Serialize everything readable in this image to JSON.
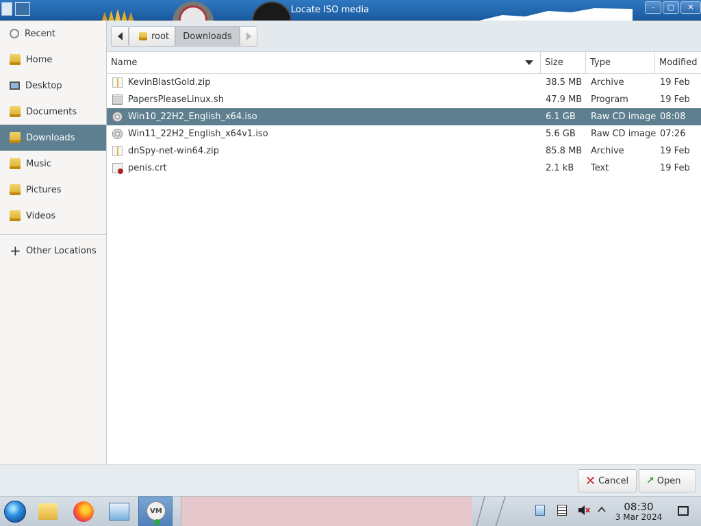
{
  "window": {
    "title": "Locate ISO media"
  },
  "sidebar": {
    "items": [
      {
        "label": "Recent"
      },
      {
        "label": "Home"
      },
      {
        "label": "Desktop"
      },
      {
        "label": "Documents"
      },
      {
        "label": "Downloads"
      },
      {
        "label": "Music"
      },
      {
        "label": "Pictures"
      },
      {
        "label": "Videos"
      }
    ],
    "other_locations": "Other Locations"
  },
  "pathbar": {
    "root": "root",
    "current": "Downloads"
  },
  "filelist": {
    "headers": {
      "name": "Name",
      "size": "Size",
      "type": "Type",
      "modified": "Modified"
    },
    "rows": [
      {
        "name": "KevinBlastGold.zip",
        "size": "38.5 MB",
        "type": "Archive",
        "modified": "19 Feb",
        "icon": "zip-icon"
      },
      {
        "name": "PapersPleaseLinux.sh",
        "size": "47.9 MB",
        "type": "Program",
        "modified": "19 Feb",
        "icon": "script-icon"
      },
      {
        "name": "Win10_22H2_English_x64.iso",
        "size": "6.1 GB",
        "type": "Raw CD image",
        "modified": "08:08",
        "icon": "disc-icon"
      },
      {
        "name": "Win11_22H2_English_x64v1.iso",
        "size": "5.6 GB",
        "type": "Raw CD image",
        "modified": "07:26",
        "icon": "disc-icon"
      },
      {
        "name": "dnSpy-net-win64.zip",
        "size": "85.8 MB",
        "type": "Archive",
        "modified": "19 Feb",
        "icon": "zip-icon"
      },
      {
        "name": "penis.crt",
        "size": "2.1 kB",
        "type": "Text",
        "modified": "19 Feb",
        "icon": "certificate-icon"
      }
    ]
  },
  "actions": {
    "cancel": "Cancel",
    "open": "Open"
  },
  "taskbar": {
    "vm_label": "VM",
    "clock_time": "08:30",
    "clock_date": "3 Mar 2024"
  },
  "colors": {
    "selection": "#5d7f8f",
    "titlebar": "#2f78c0"
  }
}
